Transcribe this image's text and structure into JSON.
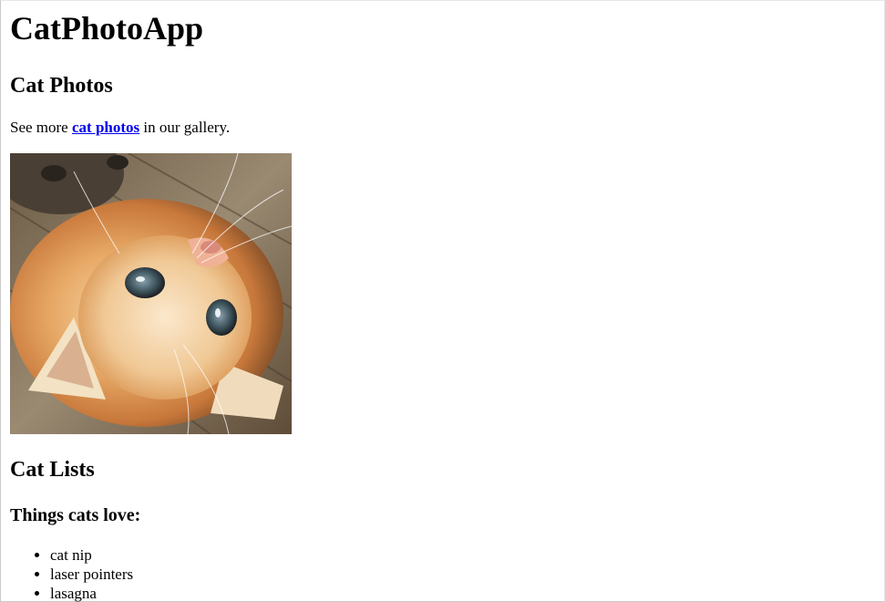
{
  "header": {
    "title": "CatPhotoApp"
  },
  "photos_section": {
    "heading": "Cat Photos",
    "text_before": "See more ",
    "link_text": "cat photos",
    "text_after": " in our gallery.",
    "image_alt": "A cute orange cat lying on its back."
  },
  "lists_section": {
    "heading": "Cat Lists",
    "subheading": "Things cats love:",
    "items": [
      "cat nip",
      "laser pointers",
      "lasagna"
    ]
  }
}
